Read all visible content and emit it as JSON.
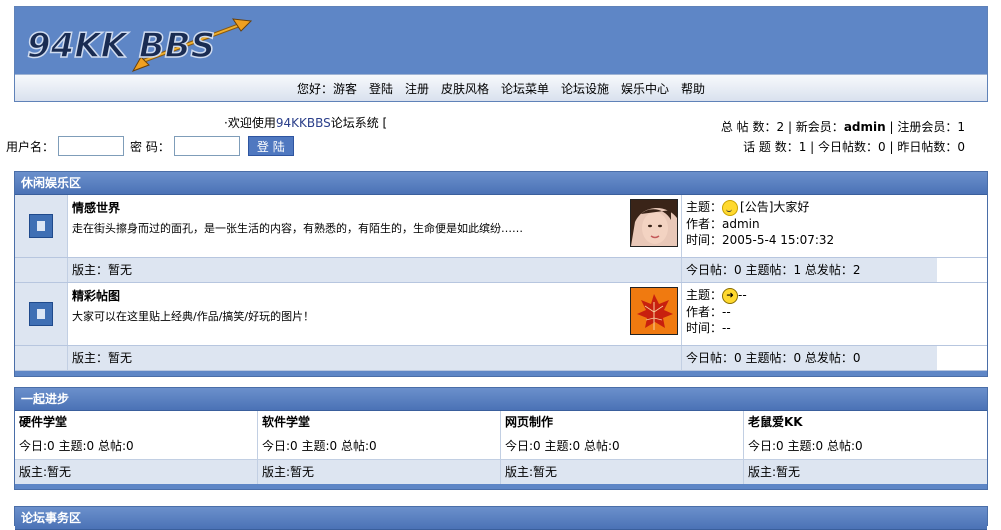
{
  "logo_text": "94KK BBS",
  "nav": [
    "您好：游客",
    "登陆",
    "注册",
    "皮肤风格",
    "论坛菜单",
    "论坛设施",
    "娱乐中心",
    "帮助"
  ],
  "welcome": {
    "prefix": "·欢迎使用",
    "site": "94KKBBS",
    "suffix": "论坛系统 ["
  },
  "login": {
    "username_label": "用户名：",
    "password_label": "密 码：",
    "button": "登 陆"
  },
  "stats": {
    "line1": {
      "label1": "总 帖 数：",
      "value1": "2",
      "label2": " | 新会员：",
      "value2": "admin",
      "label3": " | 注册会员：",
      "value3": "1"
    },
    "line2": {
      "label1": "话 题 数：",
      "value1": "1",
      "label2": " | 今日帖数：",
      "value2": "0",
      "label3": " | 昨日帖数：",
      "value3": "0"
    }
  },
  "sections": [
    {
      "title": "休闲娱乐区",
      "forums": [
        {
          "name": "情感世界",
          "desc": "走在街头擦身而过的面孔，是一张生活的内容，有熟悉的，有陌生的，生命便是如此缤纷……",
          "last_topic_label": "主题：",
          "last_topic": "[公告]大家好",
          "last_author_label": "作者：",
          "last_author": "admin",
          "last_time_label": "时间：",
          "last_time": "2005-5-4 15:07:32",
          "moderator": "版主：暂无",
          "counts": "今日帖：0 主题帖：1 总发帖：2"
        },
        {
          "name": "精彩帖图",
          "desc": "大家可以在这里贴上经典/作品/搞笑/好玩的图片！",
          "last_topic_label": "主题：",
          "last_topic": "--",
          "last_author_label": "作者：",
          "last_author": "--",
          "last_time_label": "时间：",
          "last_time": "--",
          "moderator": "版主：暂无",
          "counts": "今日帖：0 主题帖：0 总发帖：0"
        }
      ]
    },
    {
      "title": "一起进步",
      "boards": [
        {
          "name": "硬件学堂",
          "today_label": "今日:",
          "today": "0",
          "topics_label": " 主题:",
          "topics": "0",
          "total_label": " 总帖:",
          "total": "0",
          "moderator": "版主:暂无"
        },
        {
          "name": "软件学堂",
          "today_label": "今日:",
          "today": "0",
          "topics_label": " 主题:",
          "topics": "0",
          "total_label": " 总帖:",
          "total": "0",
          "moderator": "版主:暂无"
        },
        {
          "name": "网页制作",
          "today_label": "今日:",
          "today": "0",
          "topics_label": " 主题:",
          "topics": "0",
          "total_label": " 总帖:",
          "total": "0",
          "moderator": "版主:暂无"
        },
        {
          "name": "老鼠爱KK",
          "today_label": "今日:",
          "today": "0",
          "topics_label": " 主题:",
          "topics": "0",
          "total_label": " 总帖:",
          "total": "0",
          "moderator": "版主:暂无"
        }
      ]
    },
    {
      "title": "论坛事务区"
    }
  ],
  "colors": {
    "header_bg": "#5e86c6",
    "section_head": "#4b72b6",
    "row_alt": "#dde5f1",
    "link": "#2b3f8a"
  }
}
